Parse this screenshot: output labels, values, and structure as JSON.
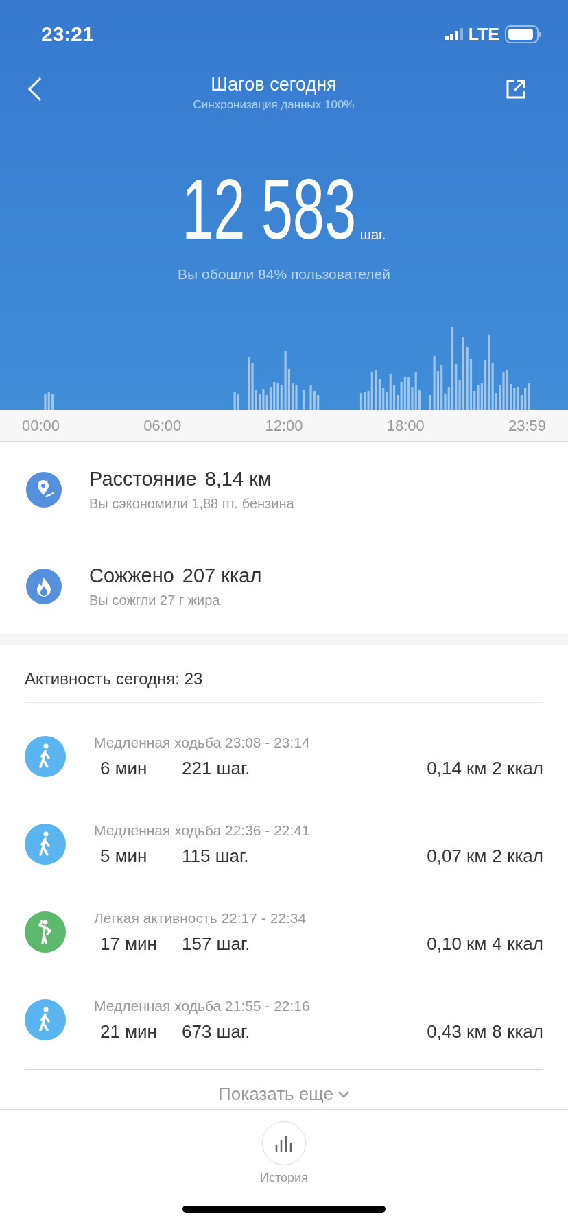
{
  "status_bar": {
    "time": "23:21",
    "network": "LTE"
  },
  "header": {
    "title": "Шагов сегодня",
    "subtitle": "Синхронизация данных 100%"
  },
  "summary": {
    "steps": "12 583",
    "unit": "шаг.",
    "comparison": "Вы обошли 84% пользователей"
  },
  "step_chart": {
    "axis_labels": [
      "00:00",
      "06:00",
      "12:00",
      "18:00",
      "23:59"
    ]
  },
  "stats": [
    {
      "kind": "distance",
      "label": "Расстояние",
      "value": "8,14 км",
      "note": "Вы сэкономили 1,88 пт. бензина"
    },
    {
      "kind": "calories",
      "label": "Сожжено",
      "value": "207 ккал",
      "note": "Вы сожгли 27 г жира"
    }
  ],
  "activity": {
    "title": "Активность сегодня: 23",
    "items": [
      {
        "kind": "walk",
        "title": "Медленная ходьба 23:08 - 23:14",
        "duration": "6 мин",
        "steps": "221 шаг.",
        "distance": "0,14 км",
        "calories": "2 ккал"
      },
      {
        "kind": "walk",
        "title": "Медленная ходьба 22:36 - 22:41",
        "duration": "5 мин",
        "steps": "115 шаг.",
        "distance": "0,07 км",
        "calories": "2 ккал"
      },
      {
        "kind": "light",
        "title": "Легкая активность 22:17 - 22:34",
        "duration": "17 мин",
        "steps": "157 шаг.",
        "distance": "0,10 км",
        "calories": "4 ккал"
      },
      {
        "kind": "walk",
        "title": "Медленная ходьба 21:55 - 22:16",
        "duration": "21 мин",
        "steps": "673 шаг.",
        "distance": "0,43 км",
        "calories": "8 ккал"
      }
    ],
    "show_more": "Показать еще"
  },
  "bottom_nav": {
    "label": "История"
  }
}
